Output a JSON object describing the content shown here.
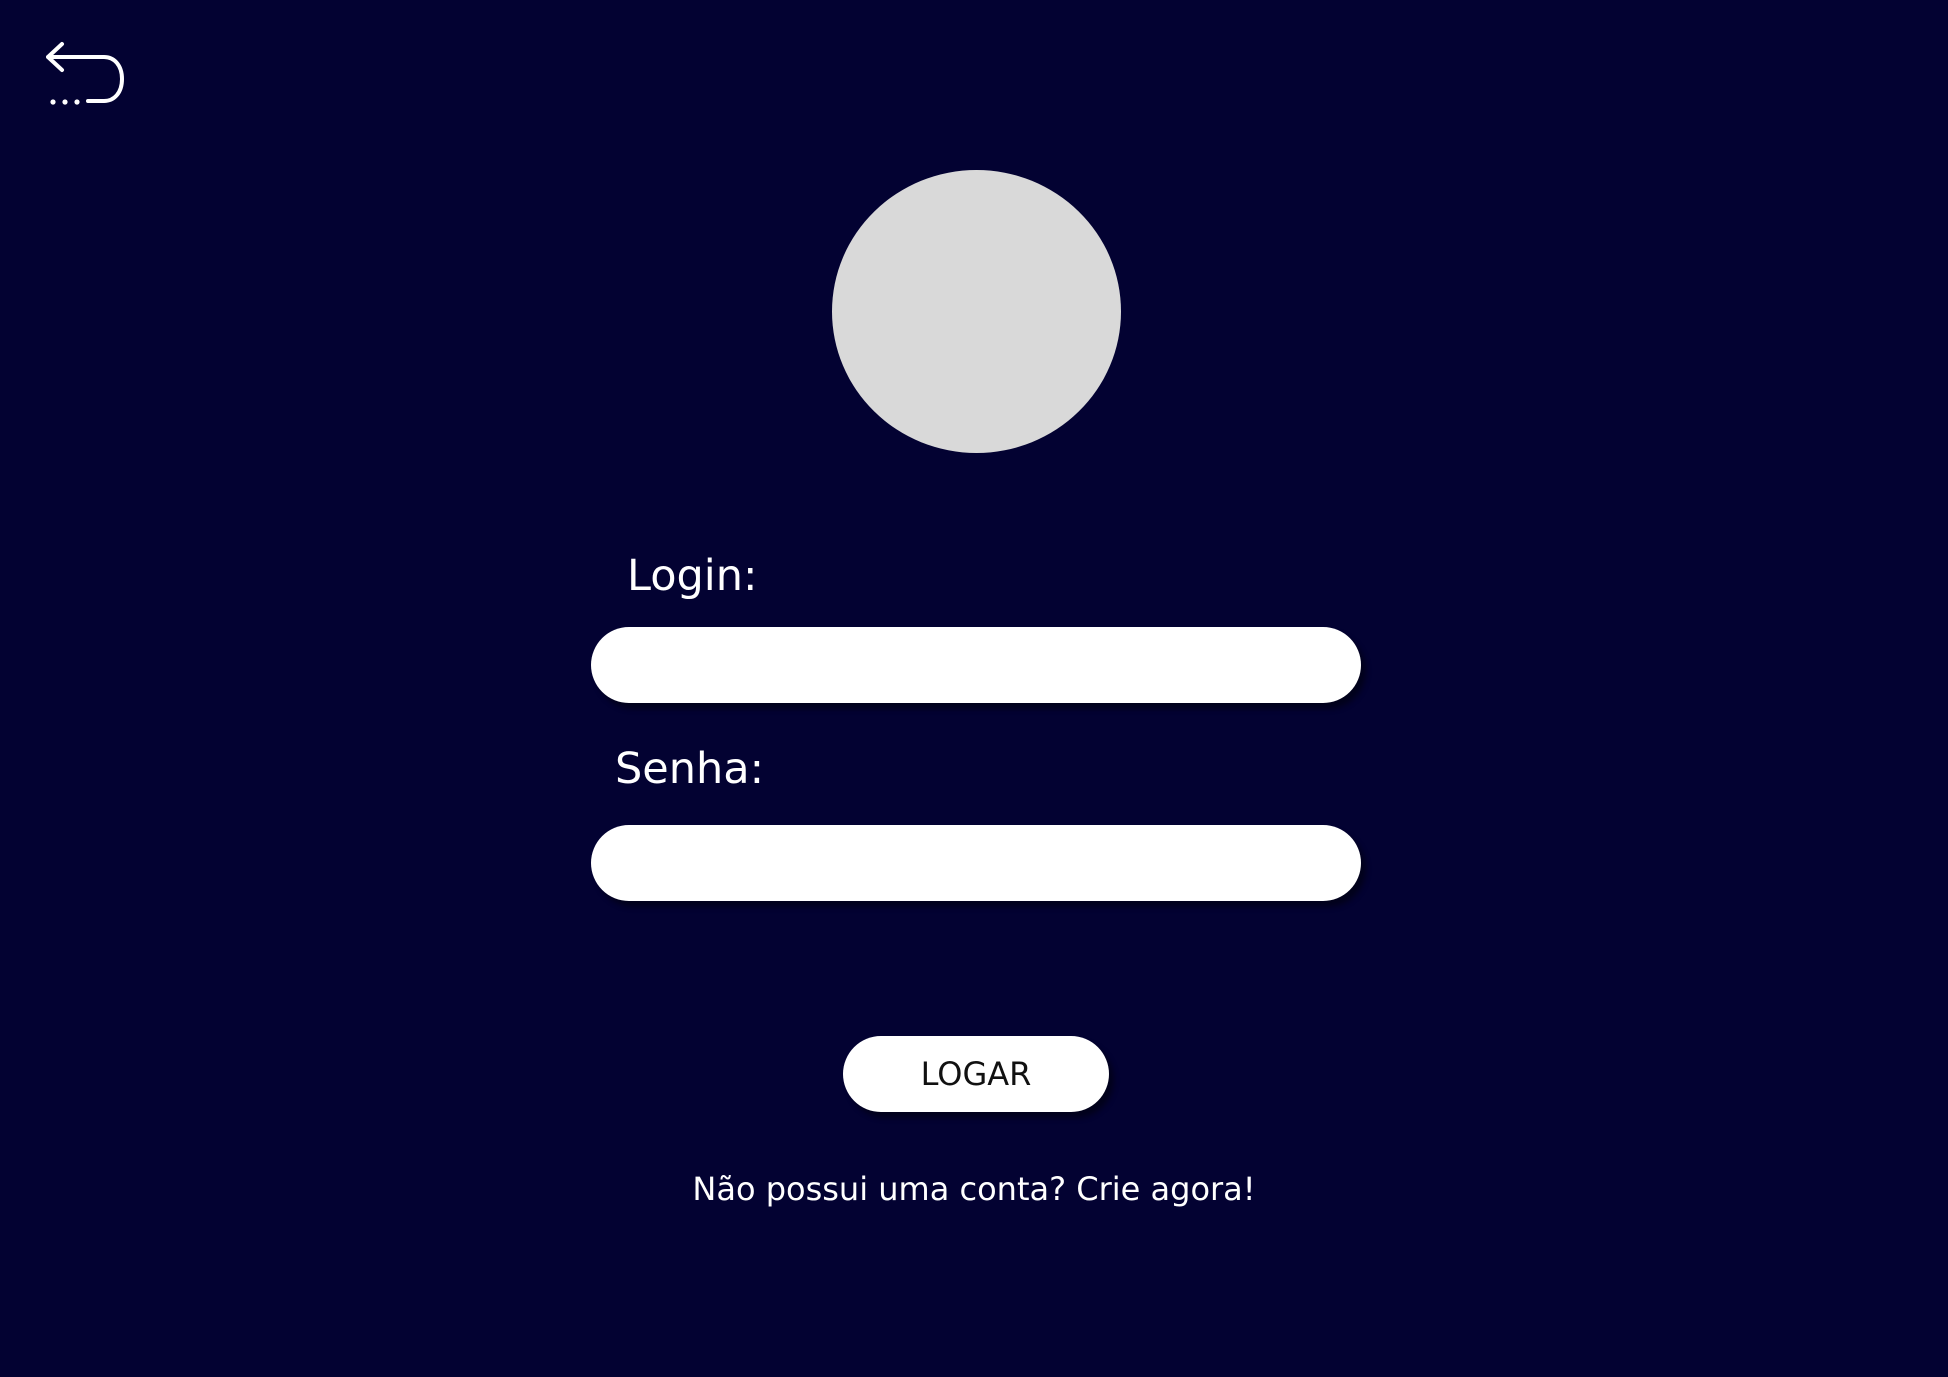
{
  "back_button": {
    "icon": "undo-arrow-icon",
    "label": ""
  },
  "avatar": {
    "icon": "avatar-placeholder",
    "color": "#d9d9d9"
  },
  "form": {
    "login_label": "Login:",
    "login_value": "",
    "senha_label": "Senha:",
    "senha_value": "",
    "submit_label": "LOGAR"
  },
  "signup": {
    "text": "Não possui uma conta? Crie agora!"
  },
  "colors": {
    "background": "#030232",
    "input_background": "#ffffff",
    "text": "#ffffff"
  }
}
